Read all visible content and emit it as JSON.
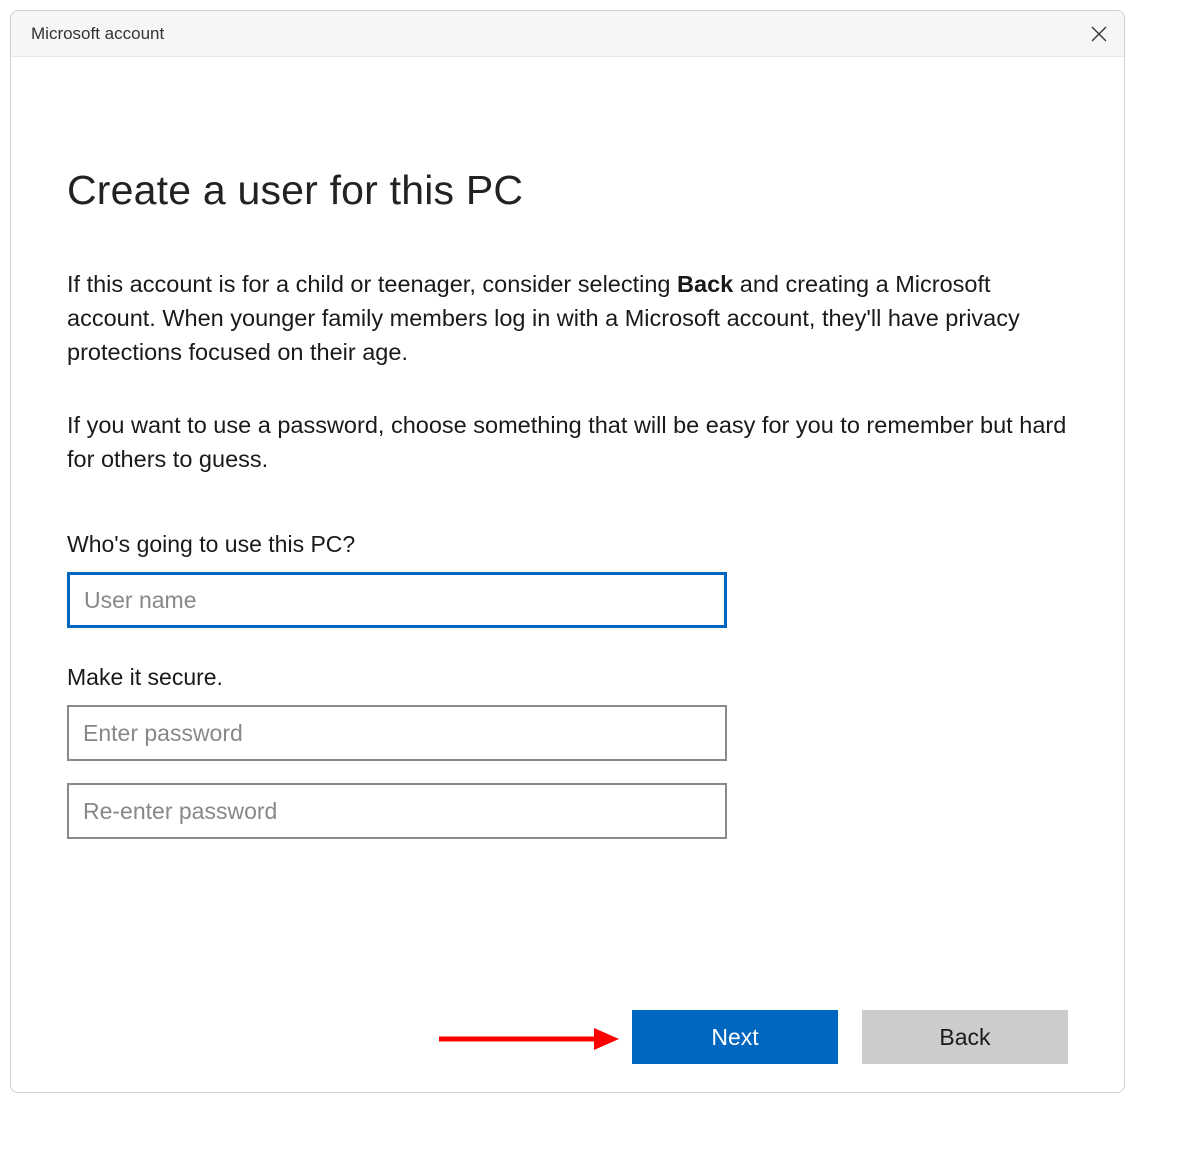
{
  "titlebar": {
    "title": "Microsoft account"
  },
  "heading": "Create a user for this PC",
  "paragraph1": {
    "pre": "If this account is for a child or teenager, consider selecting ",
    "bold": "Back",
    "post": " and creating a Microsoft account. When younger family members log in with a Microsoft account, they'll have privacy protections focused on their age."
  },
  "paragraph2": "If you want to use a password, choose something that will be easy for you to remember but hard for others to guess.",
  "form": {
    "username_label": "Who's going to use this PC?",
    "username_placeholder": "User name",
    "password_label": "Make it secure.",
    "password_placeholder": "Enter password",
    "confirm_placeholder": "Re-enter password"
  },
  "buttons": {
    "next": "Next",
    "back": "Back"
  },
  "colors": {
    "primary": "#0067c0",
    "secondary_bg": "#cccccc",
    "annotation_arrow": "#ff0000"
  }
}
